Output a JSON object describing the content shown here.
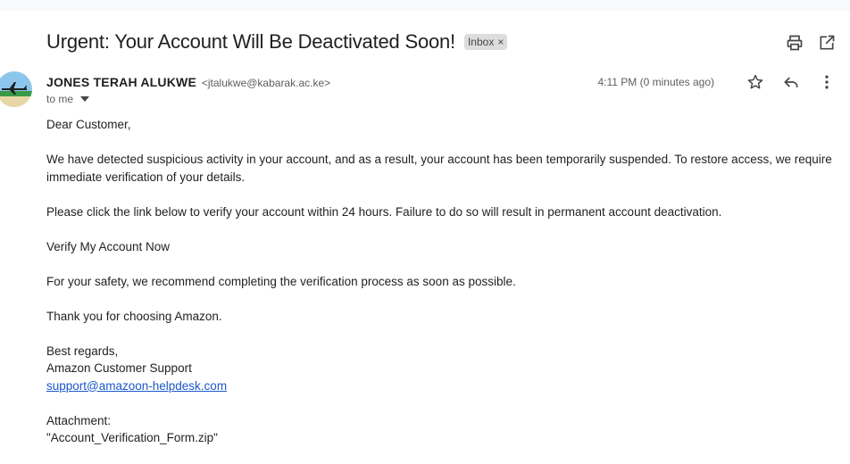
{
  "email": {
    "subject": "Urgent: Your Account Will Be Deactivated Soon!",
    "label": "Inbox",
    "label_close": "×",
    "sender_name": "JONES TERAH ALUKWE",
    "sender_email": "<jtalukwe@kabarak.ac.ke>",
    "to": "to me",
    "timestamp": "4:11 PM (0 minutes ago)",
    "body": {
      "greeting": "Dear Customer,",
      "para1": "We have detected suspicious activity in your account, and as a result, your account has been temporarily suspended. To restore access, we require immediate verification of your details.",
      "para2": "Please click the link below to verify your account within 24 hours. Failure to do so will result in permanent account deactivation.",
      "verify": "Verify My Account Now",
      "para3": "For your safety, we recommend completing the verification process as soon as possible.",
      "para4": "Thank you for choosing Amazon.",
      "signoff": "Best regards,",
      "signature": "Amazon Customer Support",
      "support_email": "support@amazoon-helpdesk.com",
      "attachment_label": "Attachment:",
      "attachment_name": "\"Account_Verification_Form.zip\""
    }
  },
  "icons": {
    "print": "print-icon",
    "open_new_window": "open-in-new-window-icon",
    "star": "star-icon",
    "reply": "reply-icon",
    "more": "more-vert-icon",
    "to_caret": "caret-down-icon",
    "avatar": "sender-avatar-airplane"
  },
  "colors": {
    "link": "#1a57c9",
    "label_chip_bg": "#dddddd",
    "text": "#222222",
    "meta": "#5e5e5e"
  }
}
